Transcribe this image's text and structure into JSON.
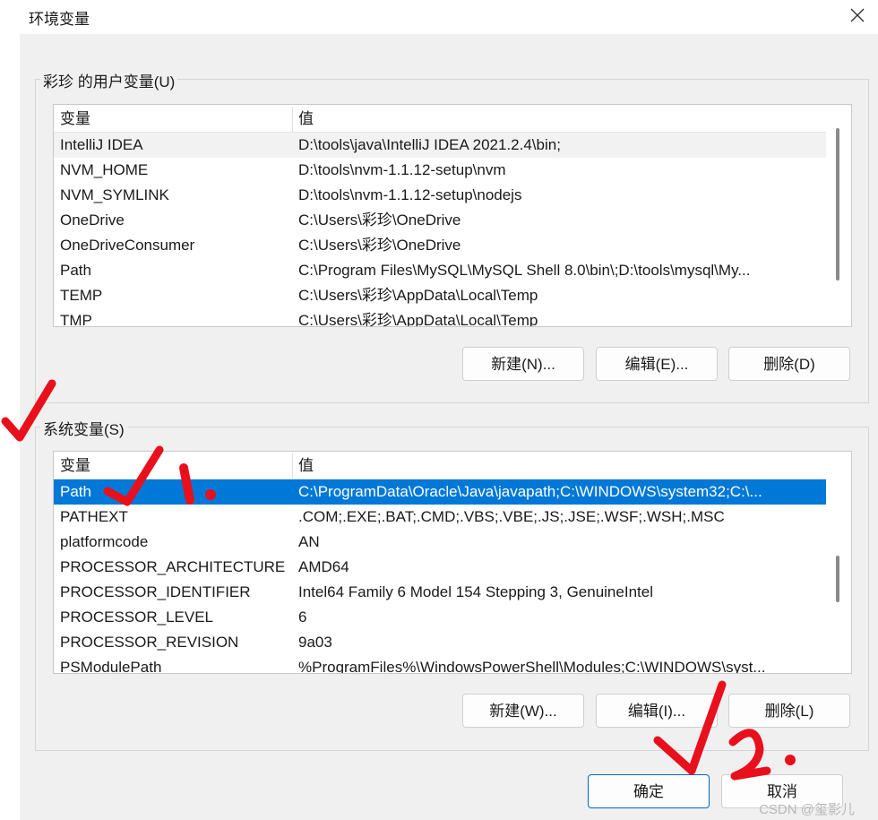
{
  "window": {
    "title": "环境变量"
  },
  "user_vars": {
    "group_label": "彩珍 的用户变量(U)",
    "col_name": "变量",
    "col_value": "值",
    "rows": [
      {
        "name": "IntelliJ IDEA",
        "value": "D:\\tools\\java\\IntelliJ IDEA 2021.2.4\\bin;"
      },
      {
        "name": "NVM_HOME",
        "value": "D:\\tools\\nvm-1.1.12-setup\\nvm"
      },
      {
        "name": "NVM_SYMLINK",
        "value": "D:\\tools\\nvm-1.1.12-setup\\nodejs"
      },
      {
        "name": "OneDrive",
        "value": "C:\\Users\\彩珍\\OneDrive"
      },
      {
        "name": "OneDriveConsumer",
        "value": "C:\\Users\\彩珍\\OneDrive"
      },
      {
        "name": "Path",
        "value": "C:\\Program Files\\MySQL\\MySQL Shell 8.0\\bin\\;D:\\tools\\mysql\\My..."
      },
      {
        "name": "TEMP",
        "value": "C:\\Users\\彩珍\\AppData\\Local\\Temp"
      },
      {
        "name": "TMP",
        "value": "C:\\Users\\彩珍\\AppData\\Local\\Temp"
      }
    ],
    "buttons": {
      "new": "新建(N)...",
      "edit": "编辑(E)...",
      "delete": "删除(D)"
    }
  },
  "system_vars": {
    "group_label": "系统变量(S)",
    "col_name": "变量",
    "col_value": "值",
    "rows": [
      {
        "name": "Path",
        "value": "C:\\ProgramData\\Oracle\\Java\\javapath;C:\\WINDOWS\\system32;C:\\..."
      },
      {
        "name": "PATHEXT",
        "value": ".COM;.EXE;.BAT;.CMD;.VBS;.VBE;.JS;.JSE;.WSF;.WSH;.MSC"
      },
      {
        "name": "platformcode",
        "value": "AN"
      },
      {
        "name": "PROCESSOR_ARCHITECTURE",
        "value": "AMD64"
      },
      {
        "name": "PROCESSOR_IDENTIFIER",
        "value": "Intel64 Family 6 Model 154 Stepping 3, GenuineIntel"
      },
      {
        "name": "PROCESSOR_LEVEL",
        "value": "6"
      },
      {
        "name": "PROCESSOR_REVISION",
        "value": "9a03"
      },
      {
        "name": "PSModulePath",
        "value": "%ProgramFiles%\\WindowsPowerShell\\Modules;C:\\WINDOWS\\syst..."
      }
    ],
    "buttons": {
      "new": "新建(W)...",
      "edit": "编辑(I)...",
      "delete": "删除(L)"
    }
  },
  "footer": {
    "ok": "确定",
    "cancel": "取消"
  },
  "watermark": "CSDN @玺影儿",
  "annotations": {
    "mark1_text": "1.",
    "mark2_text": "2.",
    "color": "#e8101c"
  },
  "colors": {
    "selection": "#0078d7",
    "primary_border": "#0067c0"
  }
}
